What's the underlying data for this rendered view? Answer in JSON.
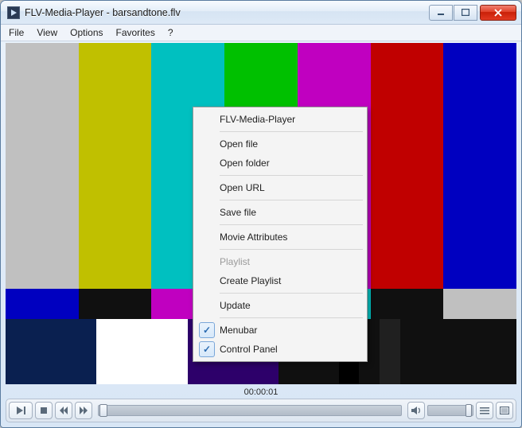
{
  "window": {
    "title": "FLV-Media-Player - barsandtone.flv"
  },
  "menubar": {
    "file": "File",
    "view": "View",
    "options": "Options",
    "favorites": "Favorites",
    "help": "?"
  },
  "context_menu": {
    "app_name": "FLV-Media-Player",
    "open_file": "Open file",
    "open_folder": "Open folder",
    "open_url": "Open URL",
    "save_file": "Save file",
    "movie_attributes": "Movie Attributes",
    "playlist": "Playlist",
    "create_playlist": "Create Playlist",
    "update": "Update",
    "menubar": "Menubar",
    "control_panel": "Control Panel",
    "menubar_checked": true,
    "control_panel_checked": true
  },
  "playback": {
    "timecode": "00:00:01"
  },
  "colorbars": {
    "main": [
      "#c0c0c0",
      "#c0c000",
      "#00c0c0",
      "#00c000",
      "#c000c0",
      "#c00000",
      "#0000c0"
    ],
    "mid": [
      "#0000c0",
      "#101010",
      "#c000c0",
      "#101010",
      "#00c0c0",
      "#101010",
      "#c0c0c0"
    ],
    "bottom_segments": [
      {
        "color": "#0a2050",
        "width": 0.178
      },
      {
        "color": "#ffffff",
        "width": 0.178
      },
      {
        "color": "#2d006a",
        "width": 0.178
      },
      {
        "color": "#101010",
        "width": 0.118
      },
      {
        "color": "#000000",
        "width": 0.04
      },
      {
        "color": "#101010",
        "width": 0.04
      },
      {
        "color": "#202020",
        "width": 0.04
      },
      {
        "color": "#101010",
        "width": 0.228
      }
    ]
  }
}
